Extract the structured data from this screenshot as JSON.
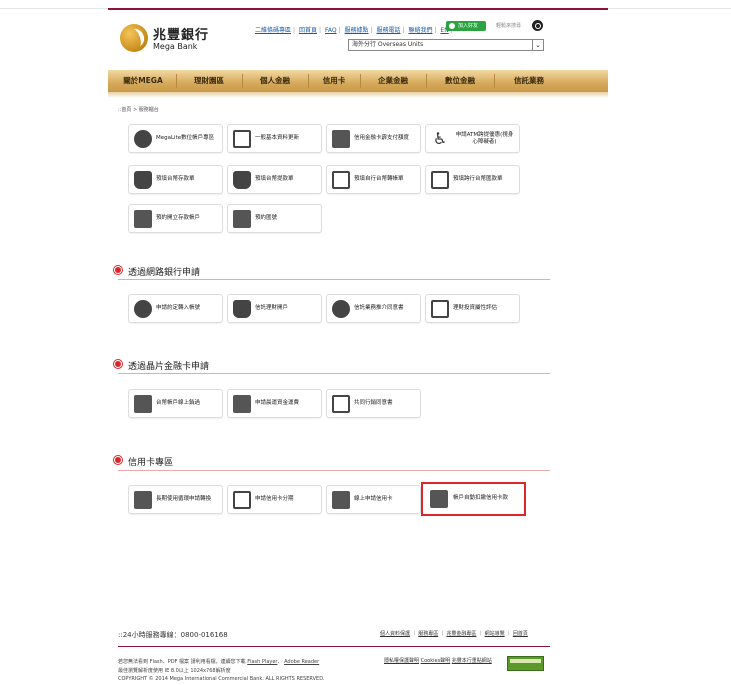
{
  "header": {
    "logo_cn": "兆豐銀行",
    "logo_en": "Mega Bank",
    "top_links": [
      "二維條碼專區",
      "回首頁",
      "FAQ",
      "服務據點",
      "服務電話",
      "聯絡我們",
      "EN"
    ],
    "join_label": "加入好友",
    "search_placeholder": "輕鬆來搜尋",
    "overseas_select": "海外分行 Overseas Units"
  },
  "nav": {
    "items": [
      "關於MEGA",
      "理財園區",
      "個人金融",
      "信用卡",
      "企業金融",
      "數位金融",
      "信託業務"
    ]
  },
  "breadcrumb": "::首頁 > 服務櫃台",
  "counter_services": [
    {
      "label": "MegaLite數位帳戶專區",
      "icon": "mega-lite-icon"
    },
    {
      "label": "一般基本資料更新",
      "icon": "profile-update-icon"
    },
    {
      "label": "信用金融卡霹支付額度",
      "icon": "debit-card-limit-icon"
    },
    {
      "label": "申請ATM跨提優惠(視身心障礙者)",
      "icon": "accessibility-icon"
    },
    {
      "label": "預填台幣存款單",
      "icon": "deposit-slip-icon"
    },
    {
      "label": "預填台幣提款單",
      "icon": "withdrawal-slip-icon"
    },
    {
      "label": "預填自行台幣轉帳單",
      "icon": "transfer-slip-icon"
    },
    {
      "label": "預填跨行台幣匯款單",
      "icon": "remittance-slip-icon"
    },
    {
      "label": "預約開立存款帳戶",
      "icon": "open-account-icon"
    },
    {
      "label": "預約匯號",
      "icon": "reservation-icon"
    }
  ],
  "sections": [
    {
      "title": "透過網路銀行申請",
      "items": [
        {
          "label": "申請約定轉入帳號",
          "icon": "designated-account-icon"
        },
        {
          "label": "信託理財開戶",
          "icon": "trust-account-icon"
        },
        {
          "label": "信託業務推介同意書",
          "icon": "trust-consent-icon"
        },
        {
          "label": "理財投資屬性評估",
          "icon": "investment-assessment-icon"
        }
      ]
    },
    {
      "title": "透過晶片金融卡申請",
      "items": [
        {
          "label": "台幣帳戶線上銷過",
          "icon": "online-cancel-icon"
        },
        {
          "label": "申請晨運資金運費",
          "icon": "fund-service-icon"
        },
        {
          "label": "共同行銷同意書",
          "icon": "joint-marketing-icon"
        }
      ]
    },
    {
      "title": "信用卡專區",
      "items": [
        {
          "label": "長期使用循環申請轉換",
          "icon": "revolving-credit-icon"
        },
        {
          "label": "申請信用卡分期",
          "icon": "installment-icon"
        },
        {
          "label": "線上申請信用卡",
          "icon": "apply-card-icon"
        },
        {
          "label": "帳戶自動扣繳信用卡款",
          "icon": "auto-debit-icon"
        }
      ]
    }
  ],
  "footer": {
    "hotline": "::24小時服務專線：0800-016168",
    "links": [
      "個人資料保護",
      "服務專區",
      "兆豐金融專區",
      "網站導覽",
      "回首頁"
    ],
    "line1_prefix": "若您無法看到 Flash、PDF 檔案 請利用看檔，連續您下載",
    "flash_link": "Flash Player",
    "adobe_link": "Adobe Reader",
    "line2": "最佳瀏覽解析度使用 IE 8.0以上 1024x768解析度",
    "copyright": "COPYRIGHT © 2014 Mega International Commercial Bank. ALL RIGHTS RESERVED.",
    "right_links": [
      "隱私權保護聲明",
      "Cookies聲明",
      "兆豐本行重點網站"
    ]
  },
  "colors": {
    "brand_red": "#8a1538",
    "accent_red": "#d8282b",
    "nav_gold": "#d6a95a",
    "link_blue": "#1a5aa6",
    "join_green": "#2ba33f"
  }
}
